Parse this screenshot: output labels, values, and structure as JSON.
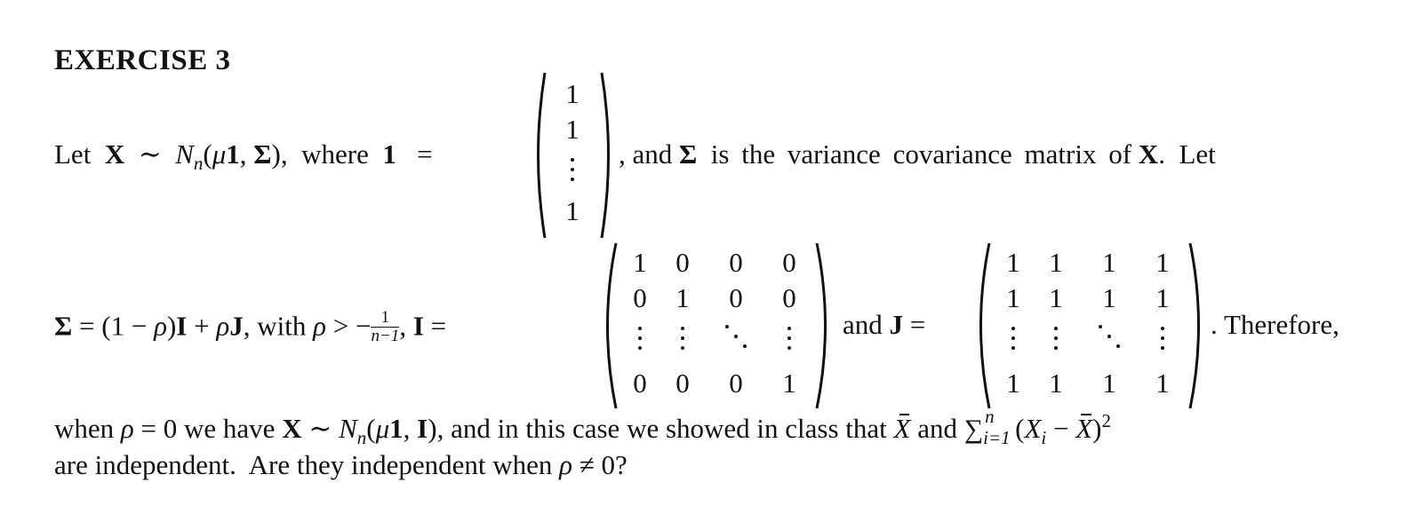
{
  "exercise": {
    "title": "EXERCISE 3"
  },
  "line1": {
    "let": "Let",
    "X": "X",
    "sim": "∼",
    "N": "N",
    "n": "n",
    "open": "(",
    "mu": "μ",
    "one": "1",
    "comma": ",",
    "Sigma": "Σ",
    "close": "),",
    "where": "where",
    "one_def": "1",
    "eq": "=",
    "after_vector": ", and",
    "Sigma2": "Σ",
    "desc": "is the variance covariance matrix of",
    "X2": "X",
    "period_let": ".  Let"
  },
  "ones_vector": {
    "entries": [
      "1",
      "1",
      "⋮",
      "1"
    ]
  },
  "line2": {
    "Sigma": "Σ",
    "eq_expr": "= (1 − ",
    "rho": "ρ",
    "close": ")",
    "I": "I",
    "plus": " + ",
    "rho2": "ρ",
    "J": "J",
    "with": ", with ",
    "rho3": "ρ",
    "gt": " > −",
    "frac_num": "1",
    "frac_den": "n−1",
    "comma": ",",
    "I2": "I",
    "eq": " =",
    "and": "and",
    "J2": "J",
    "eq2": " =",
    "therefore": ".  Therefore,"
  },
  "identity_matrix": {
    "rows": [
      [
        "1",
        "0",
        "0",
        "0"
      ],
      [
        "0",
        "1",
        "0",
        "0"
      ],
      [
        "⋮",
        "⋮",
        "⋱",
        "⋮"
      ],
      [
        "0",
        "0",
        "0",
        "1"
      ]
    ]
  },
  "ones_matrix": {
    "rows": [
      [
        "1",
        "1",
        "1",
        "1"
      ],
      [
        "1",
        "1",
        "1",
        "1"
      ],
      [
        "⋮",
        "⋮",
        "⋱",
        "⋮"
      ],
      [
        "1",
        "1",
        "1",
        "1"
      ]
    ]
  },
  "line3": {
    "when": "when ",
    "rho": "ρ",
    "eq0": " = 0 we have ",
    "X": "X",
    "sim": " ∼ ",
    "N": "N",
    "n": "n",
    "args_open": "(",
    "mu": "μ",
    "one": "1",
    "comma": ", ",
    "I": "I",
    "args_close": ")",
    "rest": ", and in this case we showed in class that ",
    "Xbar": "X",
    "and": " and ",
    "sum": "∑",
    "sum_sup": "n",
    "sum_sub": "i=1",
    "paren_open": "(",
    "Xi": "X",
    "i": "i",
    "minus": " − ",
    "Xbar2": "X",
    "paren_close": ")",
    "sq": "2"
  },
  "line4": {
    "text": "are independent.  Are they independent when ",
    "rho": "ρ",
    "neq": " ≠ 0?"
  }
}
